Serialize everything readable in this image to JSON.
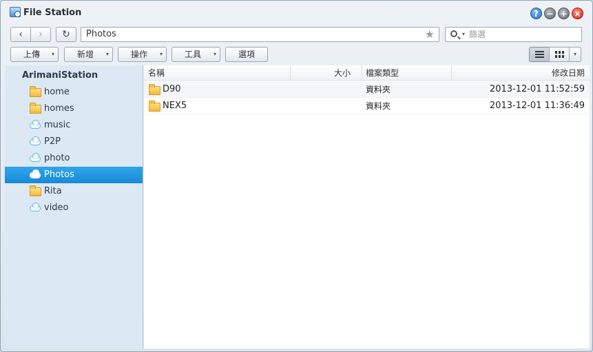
{
  "window": {
    "title": "File Station",
    "title_icon": "file-station-icon"
  },
  "title_buttons": {
    "help": "?",
    "minimize": "−",
    "maximize": "+",
    "close": "×"
  },
  "nav": {
    "back": "‹",
    "forward": "›",
    "refresh": "↻",
    "path": "Photos",
    "star": "★"
  },
  "search": {
    "placeholder": "篩選",
    "caret": "▾"
  },
  "toolbar": {
    "upload": "上傳",
    "create": "新增",
    "action": "操作",
    "tools": "工具",
    "settings": "選項",
    "caret": "▾"
  },
  "sidebar": {
    "root": "ArimaniStation",
    "items": [
      {
        "label": "home",
        "icon": "folder-icon"
      },
      {
        "label": "homes",
        "icon": "folder-icon"
      },
      {
        "label": "music",
        "icon": "cloud-icon"
      },
      {
        "label": "P2P",
        "icon": "cloud-icon"
      },
      {
        "label": "photo",
        "icon": "cloud-icon"
      },
      {
        "label": "Photos",
        "icon": "cloud-icon",
        "selected": true
      },
      {
        "label": "Rita",
        "icon": "folder-icon"
      },
      {
        "label": "video",
        "icon": "cloud-icon"
      }
    ]
  },
  "table": {
    "columns": {
      "name": "名稱",
      "size": "大小",
      "type": "檔案類型",
      "modified": "修改日期"
    },
    "rows": [
      {
        "name": "D90",
        "size": "",
        "type": "資料夾",
        "modified": "2013-12-01 11:52:59"
      },
      {
        "name": "NEX5",
        "size": "",
        "type": "資料夾",
        "modified": "2013-12-01 11:36:49"
      }
    ]
  }
}
